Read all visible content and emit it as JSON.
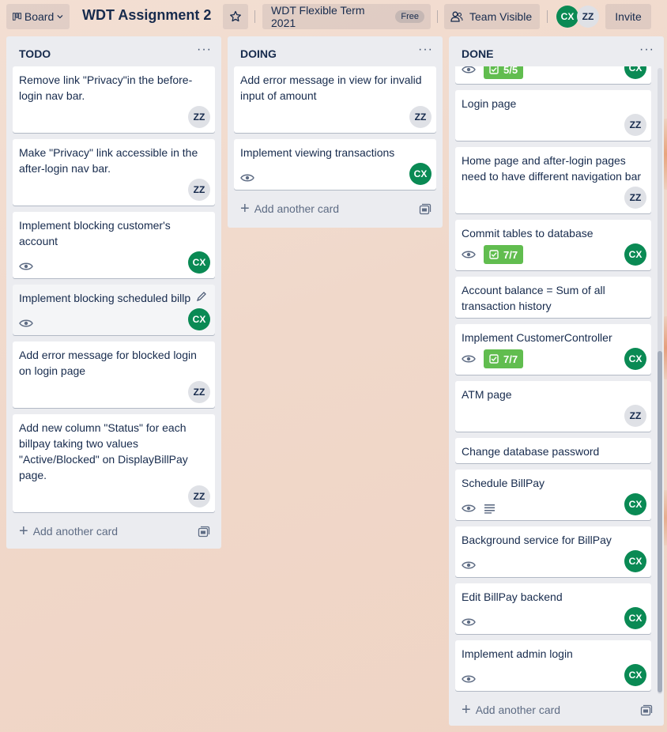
{
  "header": {
    "board_view_label": "Board",
    "board_title": "WDT Assignment 2",
    "workspace_label": "WDT Flexible Term 2021",
    "workspace_badge": "Free",
    "visibility_label": "Team Visible",
    "members": [
      "CX",
      "ZZ"
    ],
    "invite_label": "Invite"
  },
  "lists": [
    {
      "title": "TODO",
      "add_label": "Add another card",
      "cards": [
        {
          "title": "Remove link \"Privacy\"in the before-login nav bar.",
          "member": "ZZ"
        },
        {
          "title": "Make \"Privacy\" link accessible in the after-login nav bar.",
          "member": "ZZ"
        },
        {
          "title": "Implement blocking customer's account",
          "member": "CX"
        },
        {
          "title": "Implement blocking scheduled billp",
          "member": "CX"
        },
        {
          "title": "Add error message for blocked login on login page",
          "member": "ZZ"
        },
        {
          "title": "Add new column \"Status\" for each billpay taking two values \"Active/Blocked\" on DisplayBillPay page.",
          "member": "ZZ"
        }
      ]
    },
    {
      "title": "DOING",
      "add_label": "Add another card",
      "cards": [
        {
          "title": "Add error message in view for invalid input of amount",
          "member": "ZZ"
        },
        {
          "title": "Implement viewing transactions",
          "member": "CX"
        }
      ]
    },
    {
      "title": "DONE",
      "add_label": "Add another card",
      "cards": [
        {
          "title": "",
          "member": "CX",
          "checklist": "5/5"
        },
        {
          "title": "Login page",
          "member": "ZZ"
        },
        {
          "title": "Home page and after-login pages need to have different navigation bar",
          "member": "ZZ"
        },
        {
          "title": "Commit tables to database",
          "member": "CX",
          "checklist": "7/7"
        },
        {
          "title": "Account balance = Sum of all transaction history"
        },
        {
          "title": "Implement CustomerController",
          "member": "CX",
          "checklist": "7/7"
        },
        {
          "title": "ATM page",
          "member": "ZZ"
        },
        {
          "title": "Change database password"
        },
        {
          "title": "Schedule BillPay",
          "member": "CX"
        },
        {
          "title": "Background service for BillPay",
          "member": "CX"
        },
        {
          "title": "Edit BillPay backend",
          "member": "CX"
        },
        {
          "title": "Implement admin login",
          "member": "CX"
        }
      ]
    }
  ],
  "colors": {
    "cx_avatar": "#0a8a54",
    "zz_avatar": "#dfe1e6",
    "checklist_complete": "#61bd4f",
    "list_bg": "#ebecf0"
  }
}
